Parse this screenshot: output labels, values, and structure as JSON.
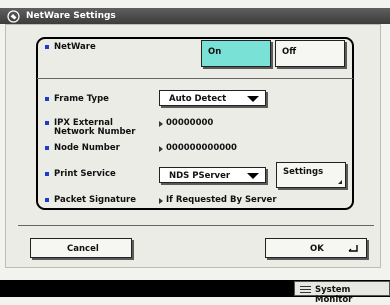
{
  "window": {
    "title": "NetWare Settings",
    "icon": "wrench-network-icon"
  },
  "rows": {
    "netware": {
      "label": "NetWare",
      "on_label": "On",
      "off_label": "Off",
      "selected": "On"
    },
    "frame_type": {
      "label": "Frame Type",
      "value": "Auto Detect"
    },
    "ipx_external": {
      "label_line1": "IPX External",
      "label_line2": "Network Number",
      "value": "00000000"
    },
    "node_number": {
      "label": "Node Number",
      "value": "000000000000"
    },
    "print_service": {
      "label": "Print Service",
      "value": "NDS PServer",
      "settings_label": "Settings"
    },
    "packet_signature": {
      "label": "Packet Signature",
      "value": "If Requested By Server"
    }
  },
  "footer": {
    "cancel_label": "Cancel",
    "ok_label": "OK"
  },
  "status_bar": {
    "system_monitor_label": "System Monitor"
  },
  "colors": {
    "title_bg": "#4a4a4a",
    "on_button": "#79e1d6",
    "bullet": "#1c3cc9"
  }
}
